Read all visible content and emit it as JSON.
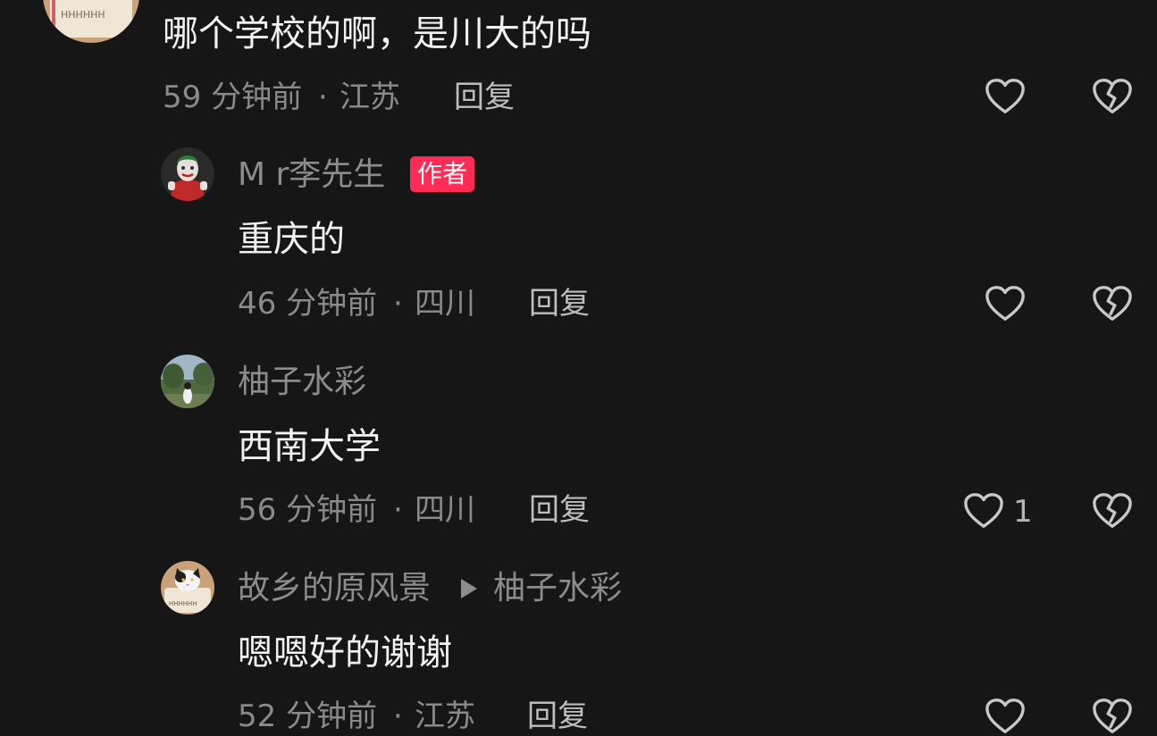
{
  "comments": [
    {
      "content": "哪个学校的啊，是川大的吗",
      "time": "59 分钟前",
      "sep": "·",
      "location": "江苏",
      "reply_label": "回复",
      "like_count": "",
      "like_icon": "heart-outline-icon",
      "dislike_icon": "broken-heart-icon"
    }
  ],
  "replies": [
    {
      "username": "M r李先生",
      "badge": "作者",
      "content": "重庆的",
      "time": "46 分钟前",
      "sep": "·",
      "location": "四川",
      "reply_label": "回复",
      "like_count": ""
    },
    {
      "username": "柚子水彩",
      "content": "西南大学",
      "time": "56 分钟前",
      "sep": "·",
      "location": "四川",
      "reply_label": "回复",
      "like_count": "1"
    },
    {
      "username": "故乡的原风景",
      "reply_to": "柚子水彩",
      "content": "嗯嗯好的谢谢",
      "time": "52 分钟前",
      "sep": "·",
      "location": "江苏",
      "reply_label": "回复",
      "like_count": ""
    }
  ],
  "colors": {
    "background": "#161616",
    "author_badge": "#fe2c55",
    "username": "#8c8c8c",
    "meta": "#8a8a8a"
  }
}
